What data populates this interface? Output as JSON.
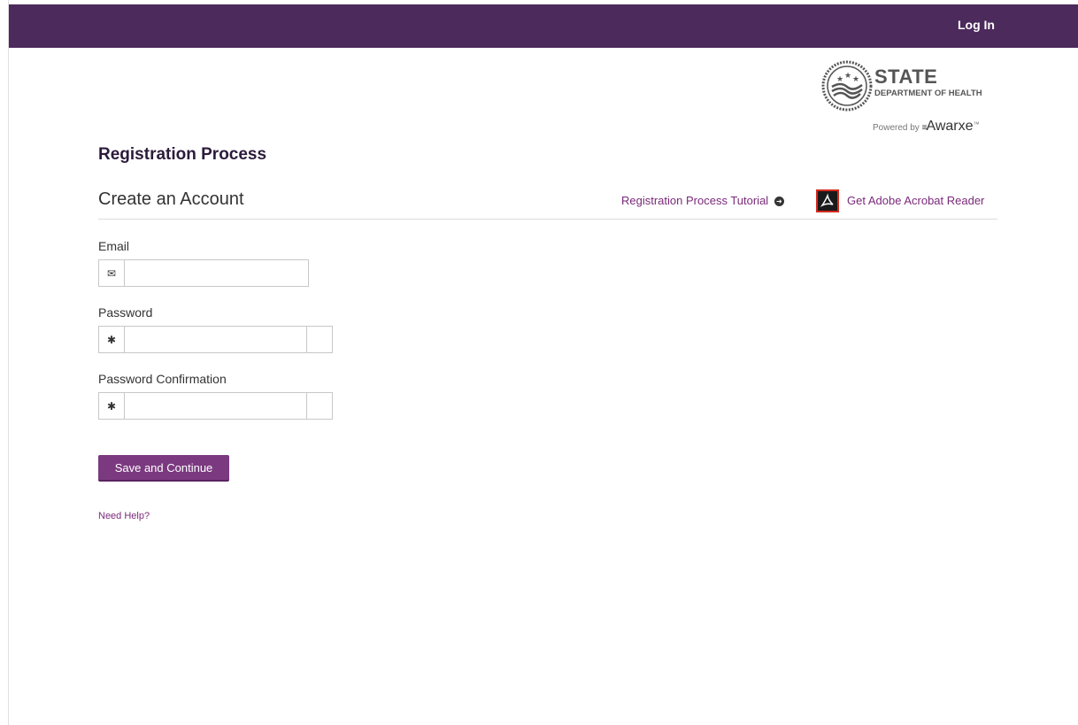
{
  "topbar": {
    "login_label": "Log In"
  },
  "logo": {
    "title": "STATE",
    "subtitle": "DEPARTMENT OF HEALTH",
    "powered_by": "Powered by",
    "brand": "Awarxe",
    "trademark": "™"
  },
  "page": {
    "title": "Registration Process",
    "section_title": "Create an Account"
  },
  "links": {
    "tutorial": "Registration Process Tutorial",
    "acrobat": "Get Adobe Acrobat Reader",
    "help": "Need Help?"
  },
  "form": {
    "email_label": "Email",
    "password_label": "Password",
    "password_confirmation_label": "Password Confirmation",
    "email_value": "",
    "password_value": "",
    "password_confirmation_value": ""
  },
  "actions": {
    "save_label": "Save and Continue"
  },
  "colors": {
    "topbar": "#4c2a5c",
    "button": "#7b3a80",
    "link": "#7a2a7a",
    "heading": "#2b1b3a"
  }
}
